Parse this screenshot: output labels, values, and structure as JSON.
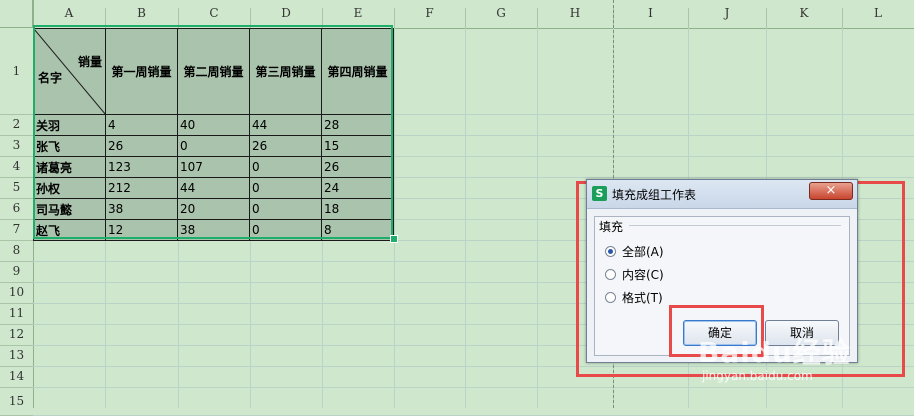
{
  "columns": [
    "A",
    "B",
    "C",
    "D",
    "E",
    "F",
    "G",
    "H",
    "I",
    "J",
    "K",
    "L"
  ],
  "rows": [
    "1",
    "2",
    "3",
    "4",
    "5",
    "6",
    "7",
    "8",
    "9",
    "10",
    "11",
    "12",
    "13",
    "14",
    "15"
  ],
  "table": {
    "diag_top": "销量",
    "diag_bottom": "名字",
    "headers": [
      "第一周销量",
      "第二周销量",
      "第三周销量",
      "第四周销量"
    ],
    "data": [
      {
        "name": "关羽",
        "values": [
          "4",
          "40",
          "44",
          "28"
        ]
      },
      {
        "name": "张飞",
        "values": [
          "26",
          "0",
          "26",
          "15"
        ]
      },
      {
        "name": "诸葛亮",
        "values": [
          "123",
          "107",
          "0",
          "26"
        ]
      },
      {
        "name": "孙权",
        "values": [
          "212",
          "44",
          "0",
          "24"
        ]
      },
      {
        "name": "司马懿",
        "values": [
          "38",
          "20",
          "0",
          "18"
        ]
      },
      {
        "name": "赵飞",
        "values": [
          "12",
          "38",
          "0",
          "8"
        ]
      }
    ]
  },
  "dialog": {
    "app_icon": "S",
    "title": "填充成组工作表",
    "close": "×",
    "group_label": "填充",
    "options": [
      {
        "label": "全部(A)",
        "checked": true
      },
      {
        "label": "内容(C)",
        "checked": false
      },
      {
        "label": "格式(T)",
        "checked": false
      }
    ],
    "ok": "确定",
    "cancel": "取消"
  },
  "watermark": {
    "text": "Baidu经验",
    "sub": "jingyan.baidu.com"
  },
  "colors": {
    "background": "#cfe8cd",
    "selection": "#1fae6a",
    "highlight": "#e84a4a"
  }
}
